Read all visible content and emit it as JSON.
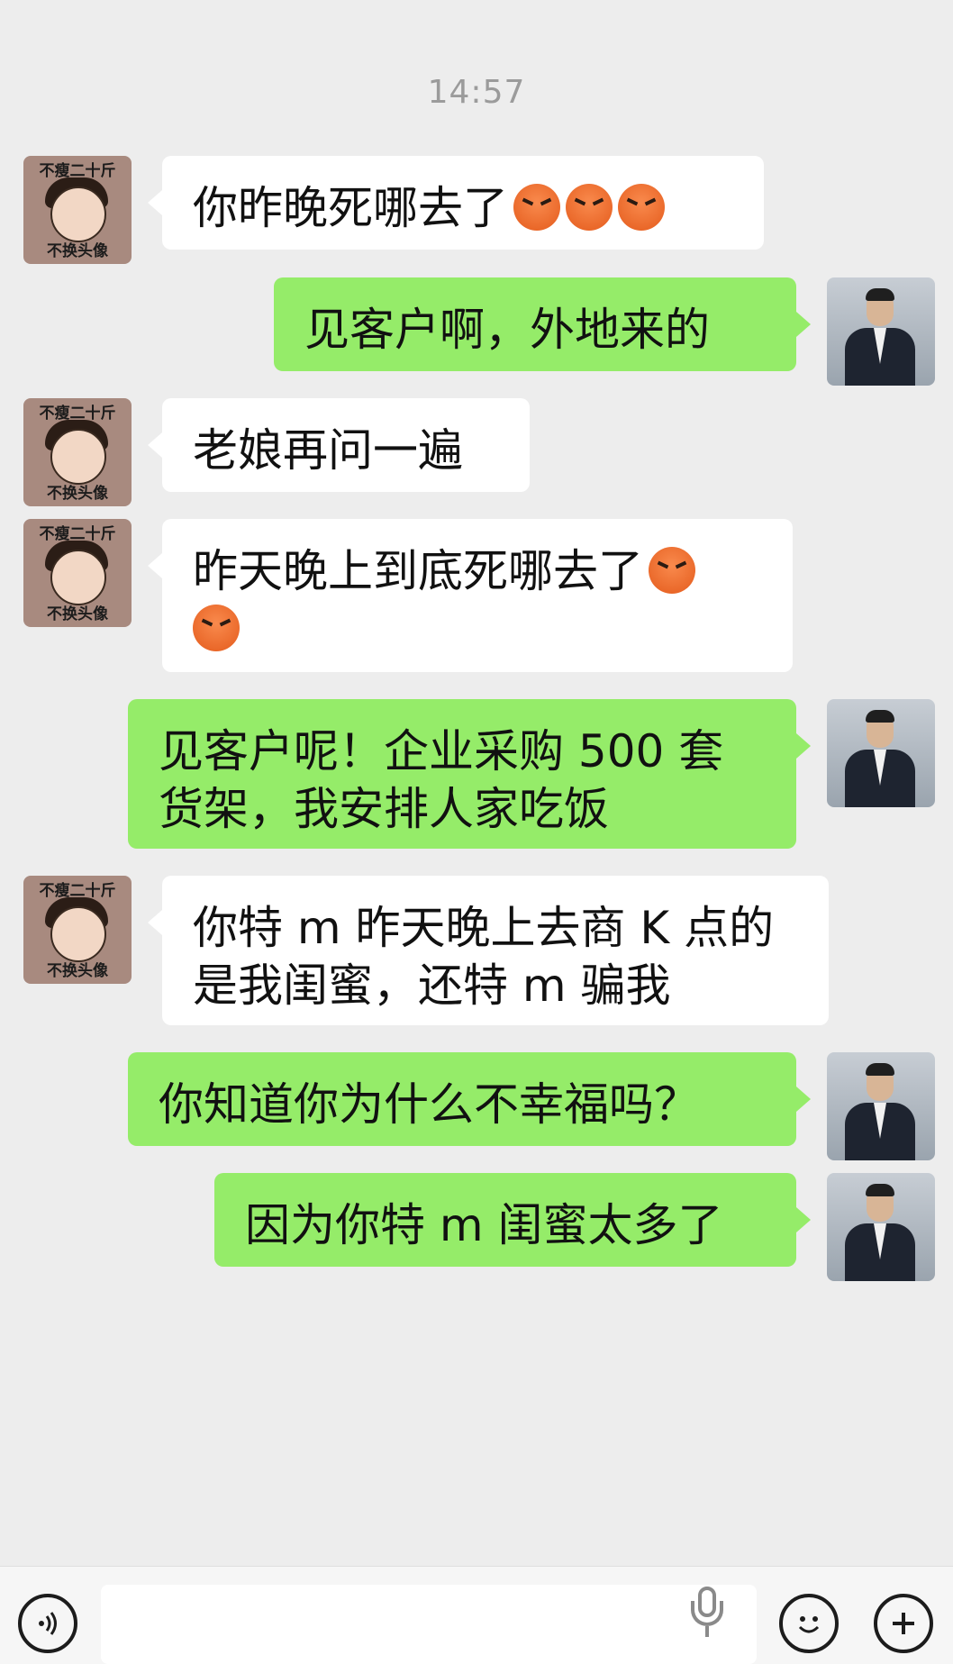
{
  "time": "14:57",
  "female_avatar": {
    "top": "不瘦二十斤",
    "bottom": "不换头像"
  },
  "messages": [
    {
      "side": "left",
      "lines": [
        "你昨晚死哪去了"
      ],
      "emoji_count": 3
    },
    {
      "side": "right",
      "lines": [
        "见客户啊，外地来的"
      ]
    },
    {
      "side": "left",
      "lines": [
        "老娘再问一遍"
      ]
    },
    {
      "side": "left",
      "lines": [
        "昨天晚上到底死哪去了"
      ],
      "emoji_count": 2
    },
    {
      "side": "right",
      "lines": [
        "见客户呢！企业采购 500 套",
        "货架，我安排人家吃饭"
      ]
    },
    {
      "side": "left",
      "lines": [
        "你特 m 昨天晚上去商 K 点的",
        "是我闺蜜，还特 m 骗我"
      ]
    },
    {
      "side": "right",
      "lines": [
        "你知道你为什么不幸福吗？"
      ]
    },
    {
      "side": "right",
      "lines": [
        "因为你特 m 闺蜜太多了"
      ]
    }
  ],
  "icons": {
    "voice": "voice-icon",
    "mic": "mic-icon",
    "emoji": "emoji-icon",
    "plus": "plus-icon"
  },
  "colors": {
    "background": "#ededed",
    "incoming_bubble": "#ffffff",
    "outgoing_bubble": "#95ec69"
  }
}
